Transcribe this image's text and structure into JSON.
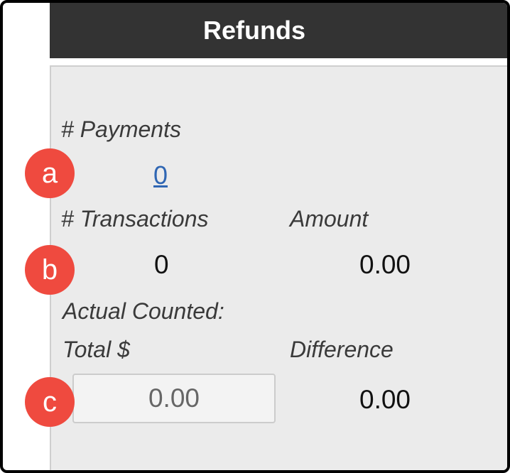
{
  "header": {
    "title": "Refunds"
  },
  "payments": {
    "label": "# Payments",
    "count": "0"
  },
  "transactions": {
    "label": "# Transactions",
    "count": "0"
  },
  "amount": {
    "label": "Amount",
    "value": "0.00"
  },
  "actual_counted": {
    "label": "Actual Counted:"
  },
  "total": {
    "label": "Total $",
    "value": "0.00"
  },
  "difference": {
    "label": "Difference",
    "value": "0.00"
  },
  "callouts": {
    "a": "a",
    "b": "b",
    "c": "c"
  },
  "colors": {
    "header_bg": "#333333",
    "panel_bg": "#ebebeb",
    "link": "#2f66b3",
    "callout": "#ef4a3f"
  }
}
